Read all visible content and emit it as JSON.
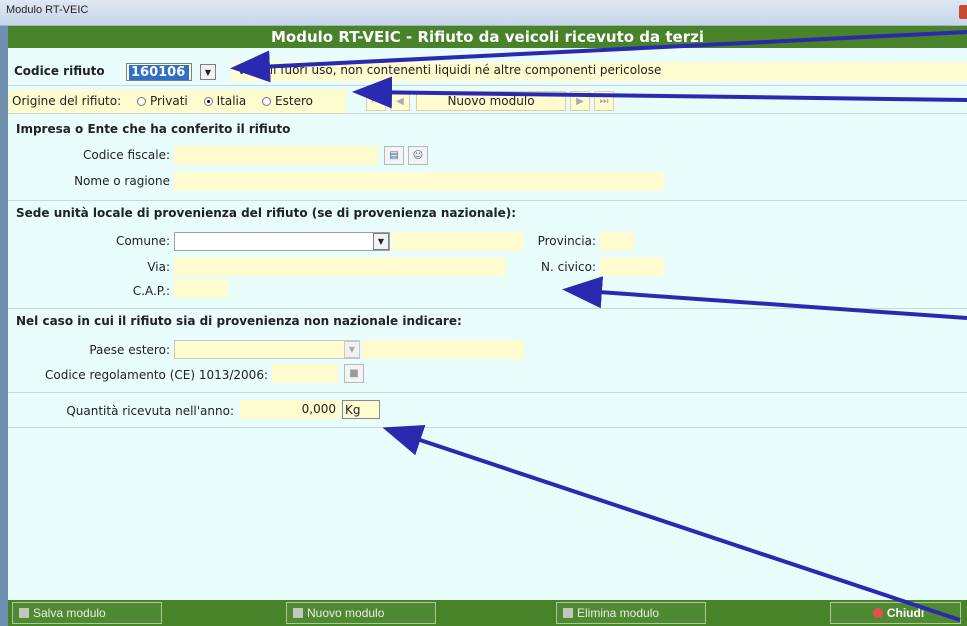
{
  "window": {
    "title": "Modulo RT-VEIC"
  },
  "header": {
    "title": "Modulo RT-VEIC - Rifiuto da veicoli ricevuto da terzi"
  },
  "codice": {
    "label": "Codice rifiuto",
    "value": "160106",
    "description": "veicoli fuori uso, non contenenti liquidi né altre componenti pericolose"
  },
  "origine": {
    "label": "Origine del rifiuto:",
    "options": [
      "Privati",
      "Italia",
      "Estero"
    ],
    "selected": "Italia",
    "nav_label": "Nuovo modulo"
  },
  "impresa": {
    "title": "Impresa o Ente che ha conferito il rifiuto",
    "codice_fiscale_label": "Codice fiscale:",
    "codice_fiscale_value": "",
    "nome_label": "Nome o ragione",
    "nome_value": ""
  },
  "sede": {
    "title": "Sede unità locale di provenienza del rifiuto (se di provenienza nazionale):",
    "comune_label": "Comune:",
    "provincia_label": "Provincia:",
    "via_label": "Via:",
    "civico_label": "N. civico:",
    "cap_label": "C.A.P.:"
  },
  "estero": {
    "title": "Nel caso in cui il rifiuto sia di provenienza non nazionale indicare:",
    "paese_label": "Paese estero:",
    "regolamento_label": "Codice regolamento (CE) 1013/2006:"
  },
  "quantita": {
    "label": "Quantità ricevuta nell'anno:",
    "value": "0,000",
    "unit": "Kg"
  },
  "footer": {
    "salva": "Salva modulo",
    "nuovo": "Nuovo modulo",
    "elimina": "Elimina modulo",
    "chiudi": "Chiudi"
  },
  "colors": {
    "header_green": "#48832a",
    "field_yellow": "#fffccf",
    "background": "#e9fdfd",
    "arrow": "#2a2ab0"
  }
}
